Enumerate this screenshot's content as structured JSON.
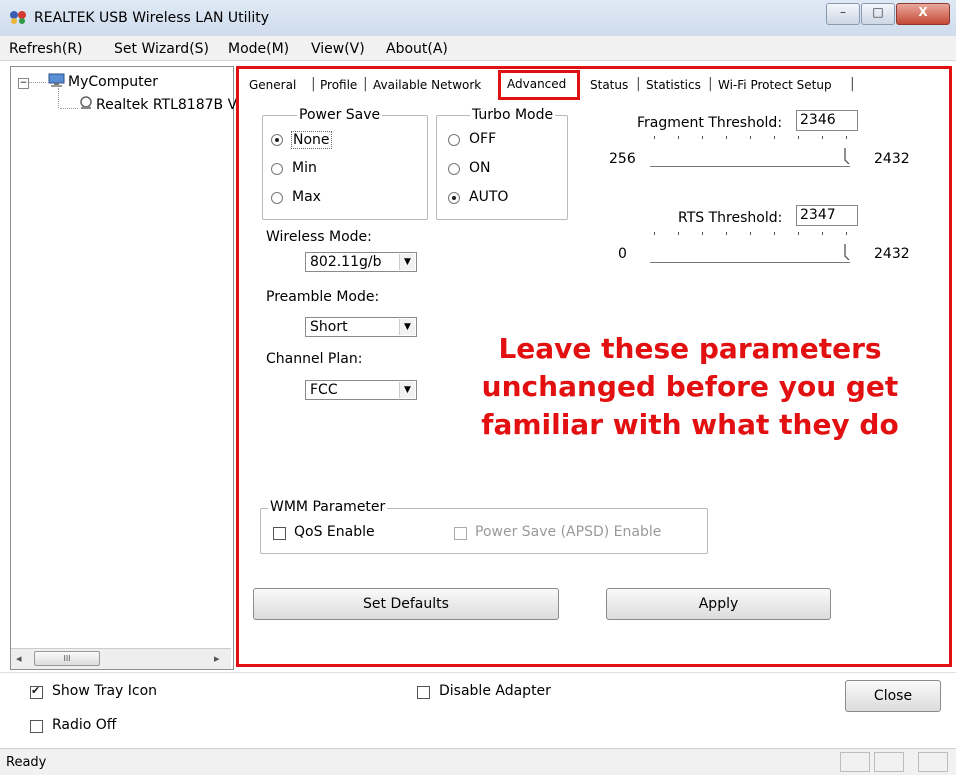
{
  "window": {
    "title": "REALTEK USB Wireless LAN Utility",
    "min_glyph": "–",
    "max_glyph": "□",
    "close_glyph": "X"
  },
  "menu": [
    "Refresh(R)",
    "Set Wizard(S)",
    "Mode(M)",
    "View(V)",
    "About(A)"
  ],
  "tree": {
    "expander": "−",
    "root": "MyComputer",
    "child": "Realtek RTL8187B V",
    "scroll_thumb": "III"
  },
  "tabs": [
    "General",
    "Profile",
    "Available Network",
    "Advanced",
    "Status",
    "Statistics",
    "Wi-Fi Protect Setup"
  ],
  "active_tab": "Advanced",
  "power_save": {
    "legend": "Power Save",
    "options": [
      "None",
      "Min",
      "Max"
    ],
    "selected": "None"
  },
  "turbo_mode": {
    "legend": "Turbo Mode",
    "options": [
      "OFF",
      "ON",
      "AUTO"
    ],
    "selected": "AUTO"
  },
  "wireless_mode": {
    "label": "Wireless Mode:",
    "value": "802.11g/b"
  },
  "preamble_mode": {
    "label": "Preamble Mode:",
    "value": "Short"
  },
  "channel_plan": {
    "label": "Channel Plan:",
    "value": "FCC"
  },
  "fragment_threshold": {
    "label": "Fragment Threshold:",
    "value": "2346",
    "min": "256",
    "max": "2432"
  },
  "rts_threshold": {
    "label": "RTS Threshold:",
    "value": "2347",
    "min": "0",
    "max": "2432"
  },
  "warning_lines": [
    "Leave these parameters",
    "unchanged before you get",
    "familiar with what they do"
  ],
  "wmm": {
    "legend": "WMM Parameter",
    "qos_label": "QoS Enable",
    "qos_checked": false,
    "apsd_label": "Power Save (APSD) Enable",
    "apsd_checked": false,
    "apsd_enabled": false
  },
  "buttons": {
    "set_defaults": "Set Defaults",
    "apply": "Apply",
    "close": "Close"
  },
  "bottom": {
    "show_tray_icon": "Show Tray Icon",
    "show_tray_icon_checked": true,
    "radio_off": "Radio Off",
    "radio_off_checked": false,
    "disable_adapter": "Disable Adapter",
    "disable_adapter_checked": false
  },
  "status": "Ready",
  "colors": {
    "highlight": "#e21010"
  }
}
